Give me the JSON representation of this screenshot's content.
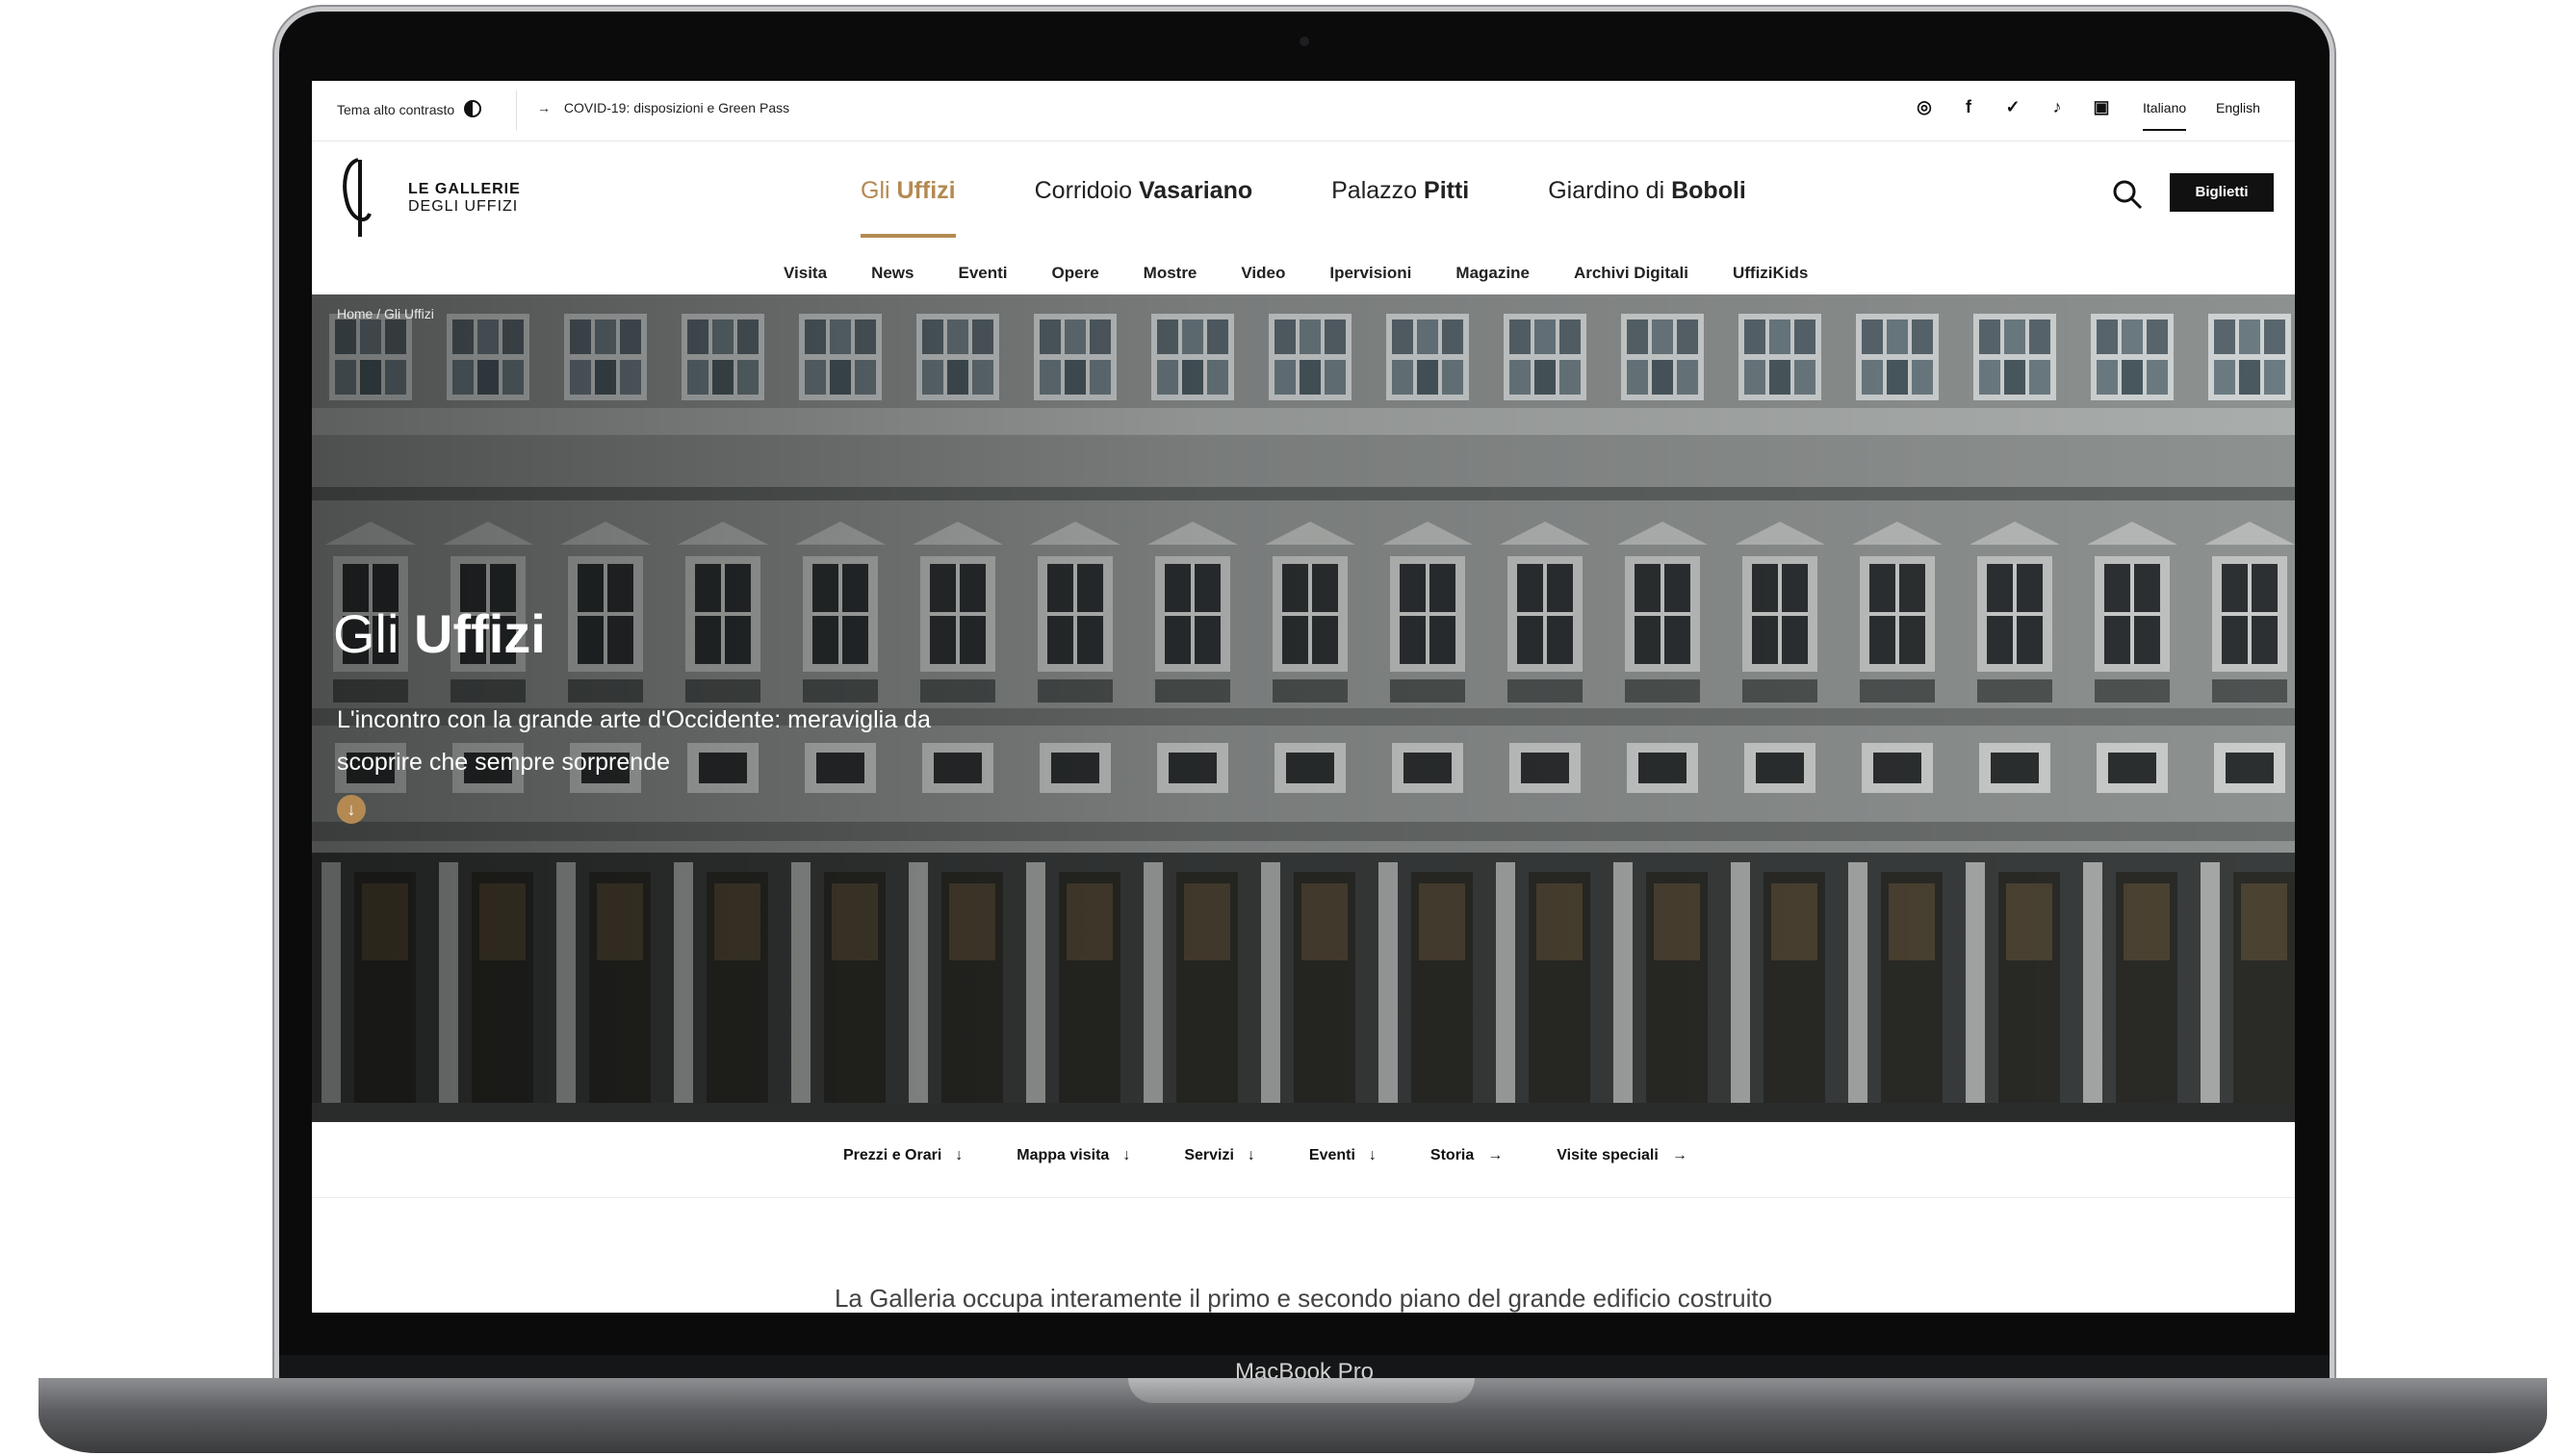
{
  "utility_bar": {
    "contrast_label": "Tema alto contrasto",
    "contrast_icon": "contrast-icon",
    "notice_arrow": "→",
    "notice_text": "COVID-19: disposizioni e Green Pass",
    "social_icons": [
      "instagram-icon",
      "facebook-icon",
      "twitter-icon",
      "tiktok-icon",
      "youtube-icon"
    ],
    "languages": [
      "Italiano",
      "English"
    ],
    "active_language": "Italiano"
  },
  "header": {
    "logo_line1": "LE GALLERIE",
    "logo_line2": "DEGLI UFFIZI",
    "main_nav": [
      {
        "prefix": "Gli ",
        "bold": "Uffizi",
        "active": true
      },
      {
        "prefix": "Corridoio ",
        "bold": "Vasariano",
        "active": false
      },
      {
        "prefix": "Palazzo ",
        "bold": "Pitti",
        "active": false
      },
      {
        "prefix": "Giardino di ",
        "bold": "Boboli",
        "active": false
      }
    ],
    "tickets_label": "Biglietti",
    "sub_nav": [
      "Visita",
      "News",
      "Eventi",
      "Opere",
      "Mostre",
      "Video",
      "Ipervisioni",
      "Magazine",
      "Archivi Digitali",
      "UffiziKids"
    ]
  },
  "hero": {
    "breadcrumb": "Home / Gli Uffizi",
    "title_prefix": "Gli ",
    "title_bold": "Uffizi",
    "subtitle": "L'incontro con la grande arte d'Occidente: meraviglia da scoprire che sempre sorprende",
    "scroll_icon": "↓"
  },
  "quick_links": [
    {
      "label": "Prezzi e Orari",
      "arrow": "↓"
    },
    {
      "label": "Mappa visita",
      "arrow": "↓"
    },
    {
      "label": "Servizi",
      "arrow": "↓"
    },
    {
      "label": "Eventi",
      "arrow": "↓"
    },
    {
      "label": "Storia",
      "arrow": "→"
    },
    {
      "label": "Visite speciali",
      "arrow": "→"
    }
  ],
  "intro_text": "La Galleria occupa interamente il primo e secondo piano del grande edificio costruito",
  "device_label": "MacBook Pro",
  "colors": {
    "accent": "#b48a52",
    "dark": "#111111",
    "bezel": "#0b0b0c"
  }
}
